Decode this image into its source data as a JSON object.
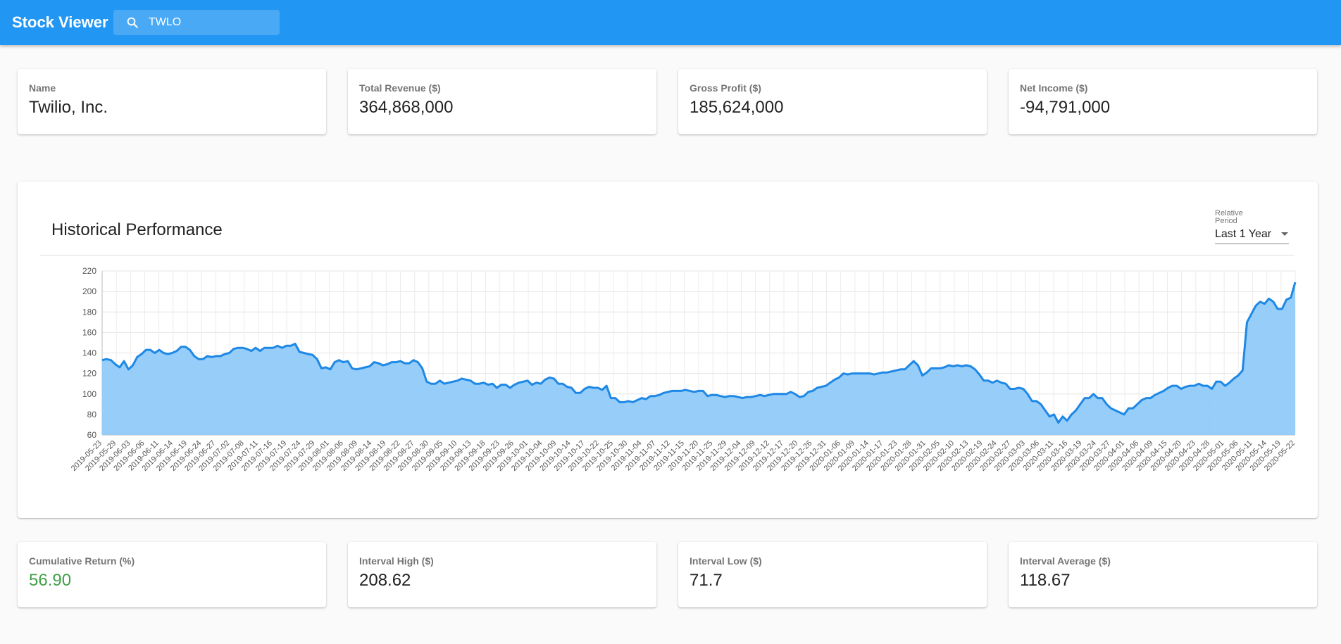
{
  "header": {
    "title": "Stock Viewer",
    "search_value": "TWLO",
    "search_icon": "search-icon"
  },
  "top_stats": [
    {
      "label": "Name",
      "value": "Twilio, Inc."
    },
    {
      "label": "Total Revenue ($)",
      "value": "364,868,000"
    },
    {
      "label": "Gross Profit ($)",
      "value": "185,624,000"
    },
    {
      "label": "Net Income ($)",
      "value": "-94,791,000"
    }
  ],
  "performance": {
    "title": "Historical Performance",
    "period_label": "Relative Period",
    "period_value": "Last 1 Year"
  },
  "bottom_stats": [
    {
      "label": "Cumulative Return (%)",
      "value": "56.90"
    },
    {
      "label": "Interval High ($)",
      "value": "208.62"
    },
    {
      "label": "Interval Low ($)",
      "value": "71.7"
    },
    {
      "label": "Interval Average ($)",
      "value": "118.67"
    }
  ],
  "colors": {
    "appbar": "#2196f3",
    "line": "#1e88e5",
    "area": "#90caf9",
    "positive": "#43a047"
  },
  "chart_data": {
    "type": "area",
    "title": "",
    "xlabel": "",
    "ylabel": "",
    "ylim": [
      60,
      220
    ],
    "yticks": [
      60,
      80,
      100,
      120,
      140,
      160,
      180,
      200,
      220
    ],
    "grid": true,
    "x_tick_labels": [
      "2019-05-23",
      "2019-05-29",
      "2019-06-03",
      "2019-06-06",
      "2019-06-11",
      "2019-06-14",
      "2019-06-19",
      "2019-06-24",
      "2019-06-27",
      "2019-07-02",
      "2019-07-08",
      "2019-07-11",
      "2019-07-16",
      "2019-07-19",
      "2019-07-24",
      "2019-07-29",
      "2019-08-01",
      "2019-08-06",
      "2019-08-09",
      "2019-08-14",
      "2019-08-19",
      "2019-08-22",
      "2019-08-27",
      "2019-08-30",
      "2019-09-05",
      "2019-09-10",
      "2019-09-13",
      "2019-09-18",
      "2019-09-23",
      "2019-09-26",
      "2019-10-01",
      "2019-10-04",
      "2019-10-09",
      "2019-10-14",
      "2019-10-17",
      "2019-10-22",
      "2019-10-25",
      "2019-10-30",
      "2019-11-04",
      "2019-11-07",
      "2019-11-12",
      "2019-11-15",
      "2019-11-20",
      "2019-11-25",
      "2019-11-29",
      "2019-12-04",
      "2019-12-09",
      "2019-12-12",
      "2019-12-17",
      "2019-12-20",
      "2019-12-26",
      "2019-12-31",
      "2020-01-06",
      "2020-01-09",
      "2020-01-14",
      "2020-01-17",
      "2020-01-23",
      "2020-01-28",
      "2020-01-31",
      "2020-02-05",
      "2020-02-10",
      "2020-02-13",
      "2020-02-19",
      "2020-02-24",
      "2020-02-27",
      "2020-03-03",
      "2020-03-06",
      "2020-03-11",
      "2020-03-16",
      "2020-03-19",
      "2020-03-24",
      "2020-03-27",
      "2020-04-01",
      "2020-04-06",
      "2020-04-09",
      "2020-04-15",
      "2020-04-20",
      "2020-04-23",
      "2020-04-28",
      "2020-05-01",
      "2020-05-06",
      "2020-05-11",
      "2020-05-14",
      "2020-05-19",
      "2020-05-22"
    ],
    "values": [
      133,
      134,
      133,
      129,
      126,
      132,
      124,
      128,
      136,
      139,
      143,
      143,
      140,
      143,
      140,
      139,
      140,
      142,
      146,
      146,
      143,
      137,
      134,
      134,
      137,
      136,
      137,
      137,
      139,
      140,
      144,
      145,
      145,
      144,
      142,
      145,
      142,
      145,
      145,
      145,
      147,
      145,
      147,
      147,
      149,
      141,
      140,
      139,
      138,
      134,
      125,
      126,
      124,
      131,
      133,
      131,
      132,
      125,
      124,
      125,
      126,
      127,
      131,
      130,
      128,
      129,
      131,
      131,
      132,
      130,
      130,
      133,
      131,
      125,
      112,
      110,
      110,
      113,
      110,
      111,
      112,
      113,
      115,
      114,
      113,
      110,
      110,
      111,
      109,
      110,
      106,
      109,
      109,
      106,
      109,
      111,
      112,
      113,
      109,
      111,
      110,
      114,
      116,
      115,
      110,
      110,
      107,
      106,
      101,
      101,
      105,
      107,
      106,
      106,
      104,
      108,
      96,
      96,
      92,
      92,
      93,
      92,
      94,
      96,
      95,
      98,
      98,
      99,
      101,
      102,
      103,
      103,
      103,
      104,
      103,
      102,
      103,
      103,
      98,
      99,
      99,
      98,
      97,
      98,
      98,
      97,
      96,
      97,
      97,
      98,
      99,
      98,
      99,
      100,
      100,
      100,
      100,
      102,
      100,
      97,
      98,
      102,
      103,
      106,
      107,
      108,
      111,
      114,
      116,
      120,
      119,
      120,
      120,
      120,
      120,
      120,
      119,
      120,
      121,
      121,
      122,
      123,
      124,
      124,
      128,
      132,
      128,
      118,
      121,
      125,
      125,
      125,
      126,
      128,
      127,
      128,
      127,
      128,
      127,
      124,
      119,
      113,
      113,
      111,
      113,
      111,
      110,
      105,
      105,
      106,
      105,
      100,
      93,
      93,
      90,
      84,
      78,
      80,
      72,
      78,
      74,
      80,
      84,
      90,
      96,
      96,
      100,
      96,
      96,
      90,
      86,
      84,
      82,
      80,
      86,
      86,
      90,
      94,
      96,
      96,
      99,
      101,
      103,
      106,
      108,
      108,
      105,
      107,
      108,
      108,
      110,
      108,
      108,
      105,
      112,
      112,
      108,
      111,
      115,
      118,
      123,
      170,
      178,
      186,
      190,
      188,
      193,
      190,
      183,
      183,
      192,
      194,
      209
    ]
  }
}
